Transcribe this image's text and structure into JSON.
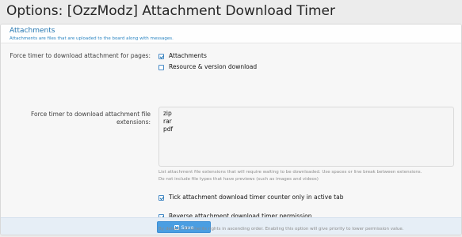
{
  "page": {
    "title": "Options: [OzzModz] Attachment Download Timer"
  },
  "section": {
    "title": "Attachments",
    "description": "Attachments are files that are uploaded to the board along with messages."
  },
  "fields": {
    "pages": {
      "label": "Force timer to download attachment for pages:",
      "options": [
        {
          "label": "Attachments",
          "checked": true
        },
        {
          "label": "Resource & version download",
          "checked": false
        }
      ]
    },
    "extensions": {
      "label_line1": "Force timer to download attachment file",
      "label_line2": "extensions:",
      "value_lines": [
        "zip",
        "rar",
        "pdf"
      ],
      "hint_line1": "List attachment file extensions that will require waiting to be downloaded. Use spaces or line break between extensions.",
      "hint_line2": "Do not include file types that have previews (such as images and videos)"
    },
    "active_tab": {
      "label": "Tick attachment download timer counter only in active tab",
      "checked": true
    },
    "reverse_permission": {
      "label": "Reverse attachment download timer permission",
      "checked": true,
      "hint": "By default, XF inherits rights in ascending order. Enabling this option will give priority to lower permission value."
    }
  },
  "footer": {
    "save_label": "Save"
  },
  "icons": {
    "save": "save-icon",
    "checkbox": "checkbox-icon"
  },
  "colors": {
    "accent": "#2577b1",
    "button": "#4a9ee2"
  }
}
